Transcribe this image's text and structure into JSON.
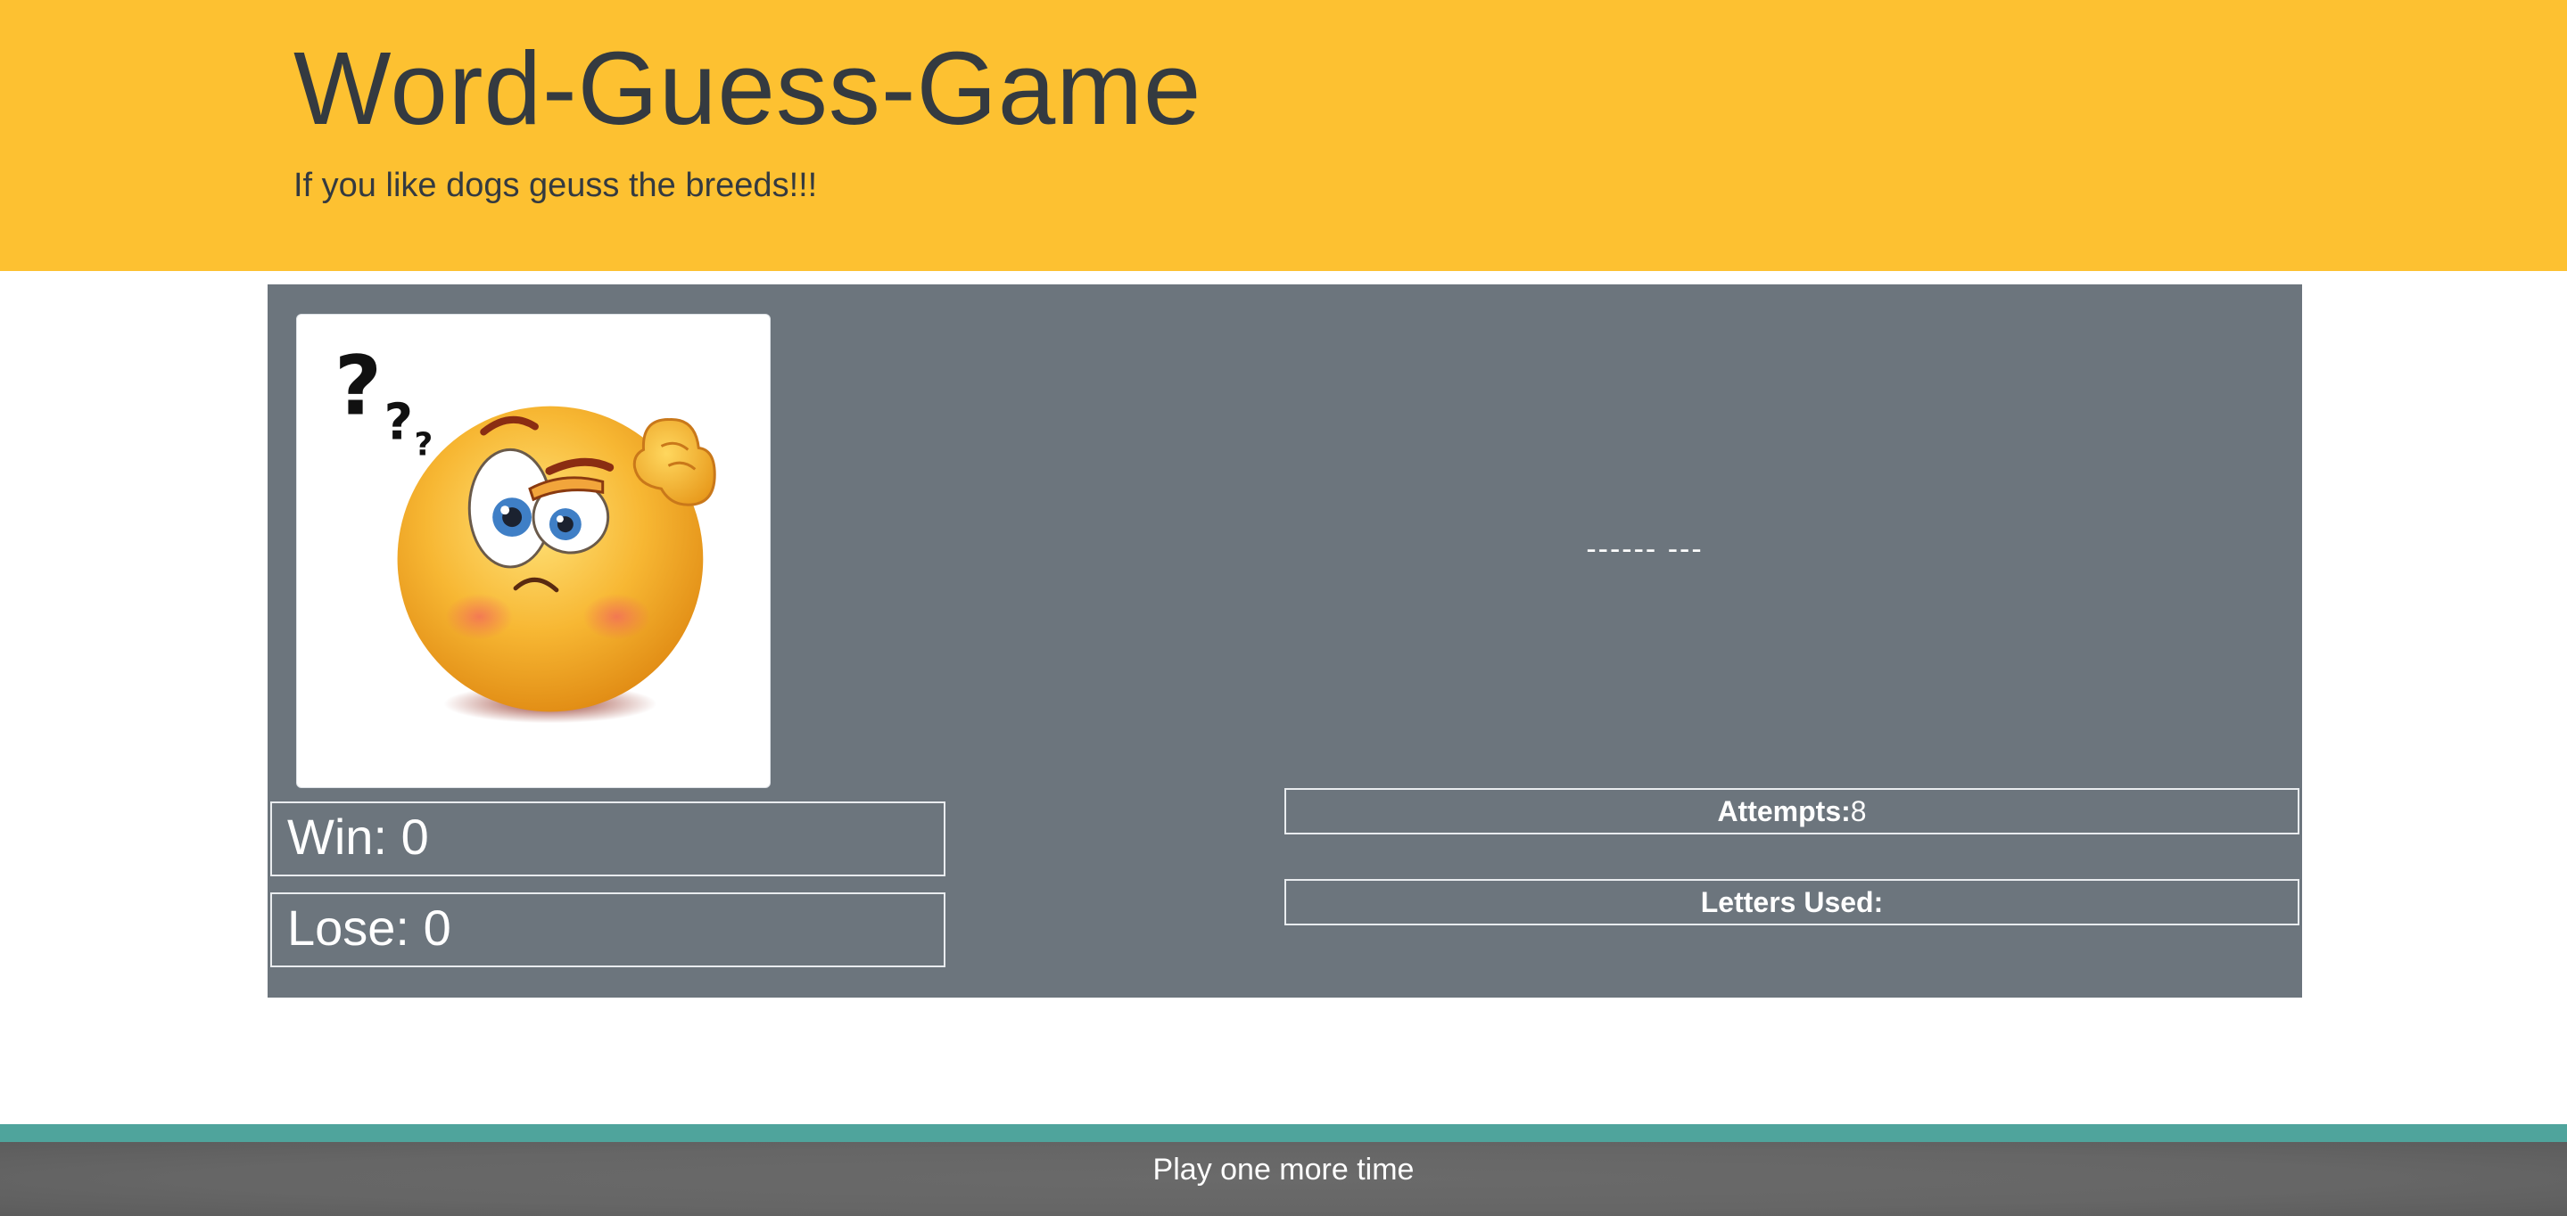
{
  "header": {
    "title": "Word-Guess-Game",
    "subtitle": "If you like dogs geuss the breeds!!!"
  },
  "game": {
    "image": {
      "icon": "thinking-emoji-icon",
      "marks": "???"
    },
    "word_display": "------ ---",
    "win": {
      "label": "Win: ",
      "value": "0"
    },
    "lose": {
      "label": "Lose: ",
      "value": "0"
    },
    "attempts": {
      "label": "Attempts:",
      "value": "8"
    },
    "letters_used": {
      "label": "Letters Used:",
      "value": ""
    }
  },
  "footer": {
    "play_again_label": "Play one more time"
  },
  "colors": {
    "header_bg": "#fdc131",
    "panel_bg": "#6c757d",
    "footer_stripe": "#4fa49c",
    "footer_bg": "#666666",
    "title_text": "#343a40"
  }
}
